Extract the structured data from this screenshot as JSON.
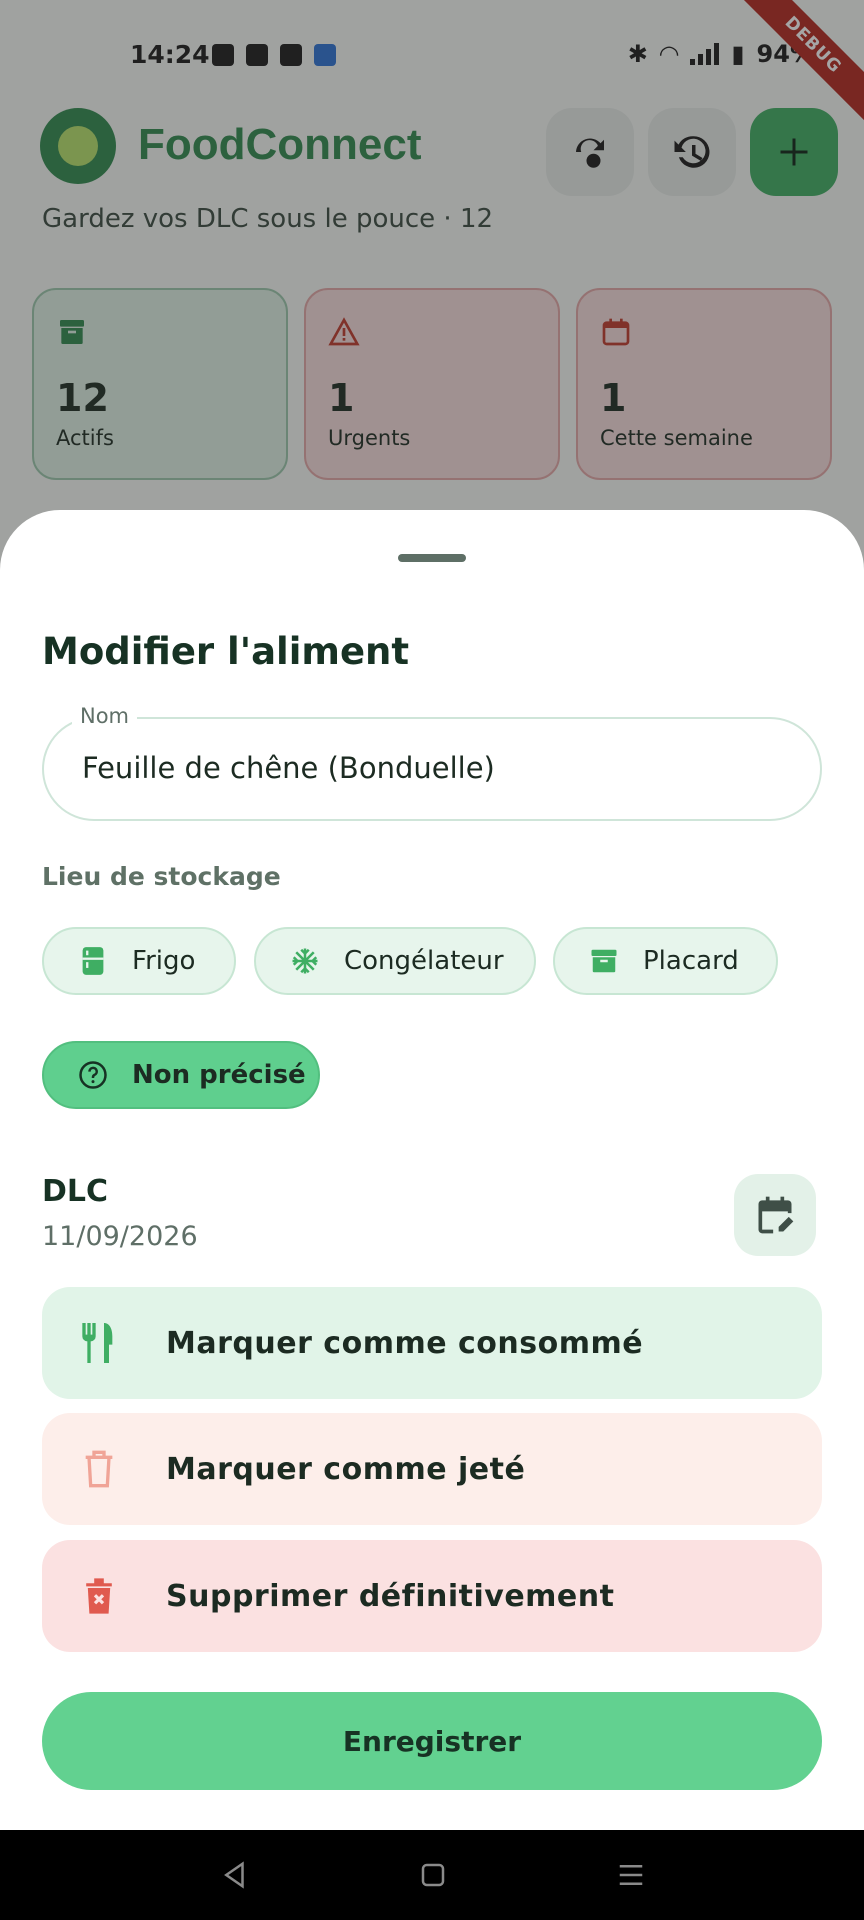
{
  "status_bar": {
    "time": "14:24",
    "battery": "94%",
    "debug_banner": "DEBUG"
  },
  "app": {
    "title": "FoodConnect",
    "subtitle": "Gardez vos DLC sous le pouce · 12",
    "header_buttons": [
      {
        "icon": "swap-icon"
      },
      {
        "icon": "history-icon"
      },
      {
        "icon": "plus-icon"
      }
    ],
    "stats": [
      {
        "value": "12",
        "label": "Actifs",
        "icon": "archive-icon"
      },
      {
        "value": "1",
        "label": "Urgents",
        "icon": "warning-icon"
      },
      {
        "value": "1",
        "label": "Cette semaine",
        "icon": "calendar-icon"
      }
    ]
  },
  "sheet": {
    "title": "Modifier l'aliment",
    "name_field": {
      "label": "Nom",
      "value": "Feuille de chêne (Bonduelle)"
    },
    "storage_label": "Lieu de stockage",
    "storage_options": [
      {
        "label": "Frigo",
        "icon": "fridge-icon",
        "selected": false
      },
      {
        "label": "Congélateur",
        "icon": "snowflake-icon",
        "selected": false
      },
      {
        "label": "Placard",
        "icon": "archive-icon",
        "selected": false
      },
      {
        "label": "Non précisé",
        "icon": "help-circle-icon",
        "selected": true
      }
    ],
    "dlc": {
      "label": "DLC",
      "value": "11/09/2026"
    },
    "actions": [
      {
        "label": "Marquer comme consommé",
        "icon": "utensils-icon",
        "tone": "green"
      },
      {
        "label": "Marquer comme jeté",
        "icon": "trash-icon",
        "tone": "peach"
      },
      {
        "label": "Supprimer définitivement",
        "icon": "delete-forever-icon",
        "tone": "red"
      }
    ],
    "save_label": "Enregistrer"
  },
  "colors": {
    "brand": "#2f8a4f",
    "accent": "#62d190",
    "danger": "#e05a4f"
  }
}
